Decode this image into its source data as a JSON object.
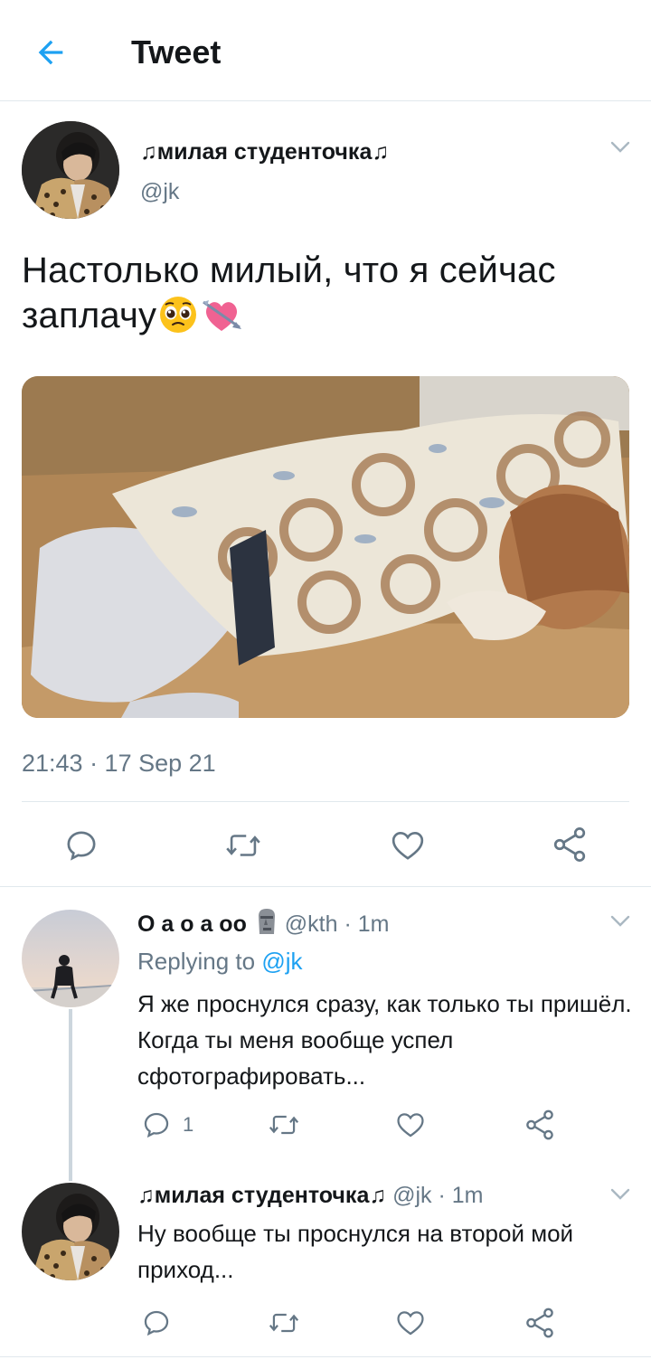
{
  "header": {
    "title": "Tweet",
    "back_icon": "arrow-left-icon"
  },
  "colors": {
    "accent": "#1da1f2",
    "muted": "#657786",
    "text": "#14171a",
    "divider": "#e1e8ed"
  },
  "main_tweet": {
    "display_name": "♫милая студенточка♫",
    "handle": "@jk",
    "text": "Настолько милый, что я сейчас заплачу",
    "emojis": [
      "pleading-face-icon",
      "heart-with-arrow-icon"
    ],
    "timestamp": "21:43 · 17 Sep 21",
    "actions": [
      "reply-icon",
      "retweet-icon",
      "like-icon",
      "share-icon"
    ]
  },
  "replies": [
    {
      "display_name": "O a o a oo",
      "name_emoji": "moai-icon",
      "handle": "@kth",
      "separator": "·",
      "time": "1m",
      "replying_prefix": "Replying to",
      "replying_to": "@jk",
      "text": "Я же проснулся сразу, как только ты пришёл. Когда ты меня вообще успел сфотографировать...",
      "reply_count": "1"
    },
    {
      "display_name": "♫милая студенточка♫",
      "handle": "@jk",
      "separator": "·",
      "time": "1m",
      "text": "Ну вообще ты проснулся на второй мой приход...",
      "reply_count": ""
    }
  ]
}
